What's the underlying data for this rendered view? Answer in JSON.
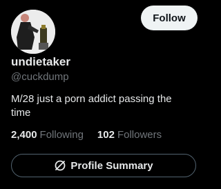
{
  "profile": {
    "display_name": "undietaker",
    "handle": "@cuckdump",
    "bio": "M/28 just a porn addict passing the time",
    "avatar": "avatar-photo"
  },
  "actions": {
    "follow_label": "Follow",
    "summary_label": "Profile Summary",
    "summary_icon": "grok-icon"
  },
  "stats": {
    "following_count": "2,400",
    "following_label": "Following",
    "followers_count": "102",
    "followers_label": "Followers"
  },
  "colors": {
    "background": "#000000",
    "text_primary": "#e7e9ea",
    "text_secondary": "#71767b",
    "button_light": "#eff3f4",
    "border": "#536471"
  }
}
